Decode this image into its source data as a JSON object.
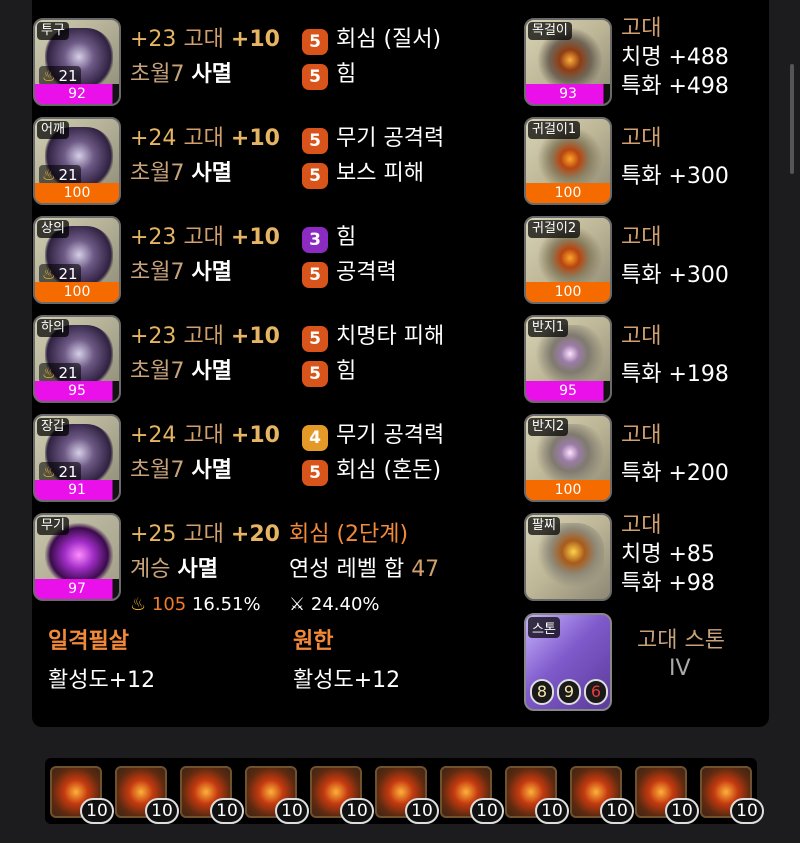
{
  "equipment": [
    {
      "slot": "투구",
      "tier": "21",
      "quality": "92",
      "quality_color": "#ea10ea",
      "honing": "+23",
      "grade": "고대",
      "advanced": "+10",
      "set_level": "초월7",
      "set_name": "사멸",
      "effects": [
        {
          "lvl": "5",
          "name": "회심 (질서)"
        },
        {
          "lvl": "5",
          "name": "힘"
        }
      ]
    },
    {
      "slot": "어깨",
      "tier": "21",
      "quality": "100",
      "quality_color": "#f56b00",
      "honing": "+24",
      "grade": "고대",
      "advanced": "+10",
      "set_level": "초월7",
      "set_name": "사멸",
      "effects": [
        {
          "lvl": "5",
          "name": "무기 공격력"
        },
        {
          "lvl": "5",
          "name": "보스 피해"
        }
      ]
    },
    {
      "slot": "상의",
      "tier": "21",
      "quality": "100",
      "quality_color": "#f56b00",
      "honing": "+23",
      "grade": "고대",
      "advanced": "+10",
      "set_level": "초월7",
      "set_name": "사멸",
      "effects": [
        {
          "lvl": "3",
          "name": "힘"
        },
        {
          "lvl": "5",
          "name": "공격력"
        }
      ]
    },
    {
      "slot": "하의",
      "tier": "21",
      "quality": "95",
      "quality_color": "#ea10ea",
      "honing": "+23",
      "grade": "고대",
      "advanced": "+10",
      "set_level": "초월7",
      "set_name": "사멸",
      "effects": [
        {
          "lvl": "5",
          "name": "치명타 피해"
        },
        {
          "lvl": "5",
          "name": "힘"
        }
      ]
    },
    {
      "slot": "장갑",
      "tier": "21",
      "quality": "91",
      "quality_color": "#ea10ea",
      "honing": "+24",
      "grade": "고대",
      "advanced": "+10",
      "set_level": "초월7",
      "set_name": "사멸",
      "effects": [
        {
          "lvl": "4",
          "name": "무기 공격력"
        },
        {
          "lvl": "5",
          "name": "회심 (혼돈)"
        }
      ]
    }
  ],
  "weapon": {
    "slot": "무기",
    "quality": "97",
    "honing": "+25",
    "grade": "고대",
    "advanced": "+20",
    "set_level": "계승",
    "set_name": "사멸",
    "elixir_option": "회심 (2단계)",
    "elixir_total_label": "연성 레벨 합",
    "elixir_total": "47",
    "transcend_points": "105",
    "transcend_pct": "16.51%",
    "weapon_pct": "24.40%"
  },
  "set_effects": [
    {
      "name": "일격필살",
      "value": "활성도+12"
    },
    {
      "name": "원한",
      "value": "활성도+12"
    }
  ],
  "accessories": [
    {
      "slot": "목걸이",
      "quality": "93",
      "quality_color": "#ea10ea",
      "grade": "고대",
      "stats": [
        "치명 +488",
        "특화 +498"
      ]
    },
    {
      "slot": "귀걸이1",
      "quality": "100",
      "quality_color": "#f56b00",
      "grade": "고대",
      "stats": [
        "특화 +300"
      ]
    },
    {
      "slot": "귀걸이2",
      "quality": "100",
      "quality_color": "#f56b00",
      "grade": "고대",
      "stats": [
        "특화 +300"
      ]
    },
    {
      "slot": "반지1",
      "quality": "95",
      "quality_color": "#ea10ea",
      "grade": "고대",
      "stats": [
        "특화 +198"
      ]
    },
    {
      "slot": "반지2",
      "quality": "100",
      "quality_color": "#f56b00",
      "grade": "고대",
      "stats": [
        "특화 +200"
      ]
    },
    {
      "slot": "팔찌",
      "grade": "고대",
      "stats": [
        "치명 +85",
        "특화 +98"
      ]
    }
  ],
  "stone": {
    "slot": "스톤",
    "name": "고대 스톤",
    "tier": "IV",
    "engraves": [
      "8",
      "9",
      "6"
    ]
  },
  "gems": [
    "10",
    "10",
    "10",
    "10",
    "10",
    "10",
    "10",
    "10",
    "10",
    "10",
    "10"
  ],
  "colors": {
    "pink_quality": "#ea10ea",
    "orange_quality": "#f56b00",
    "badge_5": "#d9541a",
    "badge_3": "#8b2bc2",
    "badge_4": "#e59a27",
    "gold_text": "#e6b563"
  }
}
